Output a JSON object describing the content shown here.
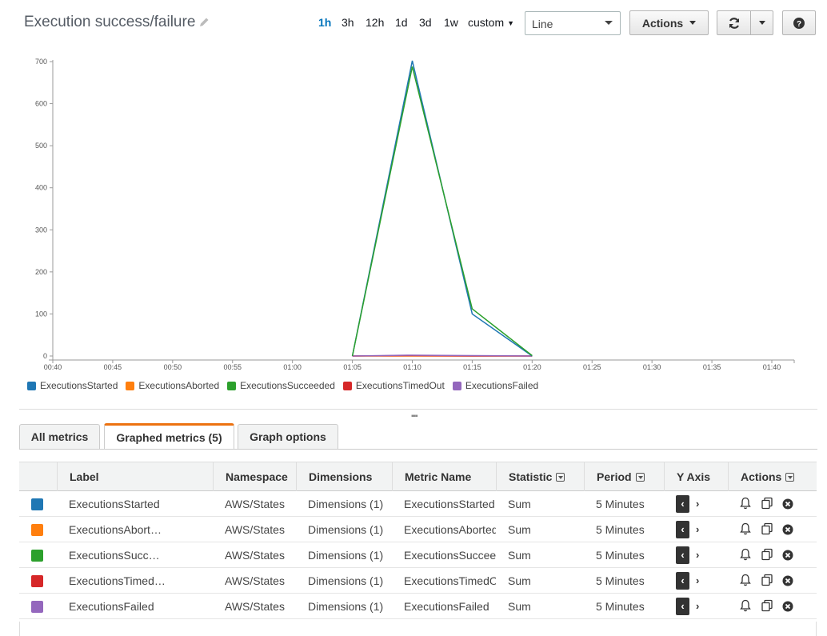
{
  "header": {
    "title": "Execution success/failure",
    "time_ranges": [
      "1h",
      "3h",
      "12h",
      "1d",
      "3d",
      "1w"
    ],
    "active_range": "1h",
    "custom_label": "custom",
    "graph_type": "Line",
    "actions_label": "Actions"
  },
  "chart_data": {
    "type": "line",
    "x": [
      "00:40",
      "00:45",
      "00:50",
      "00:55",
      "01:00",
      "01:05",
      "01:10",
      "01:15",
      "01:20",
      "01:25",
      "01:30",
      "01:35",
      "01:40"
    ],
    "ylim": [
      0,
      700
    ],
    "yticks": [
      "0",
      "100",
      "200",
      "300",
      "400",
      "500",
      "600",
      "700"
    ],
    "series": [
      {
        "name": "ExecutionsStarted",
        "color": "#1f77b4",
        "points": [
          [
            "01:05",
            0
          ],
          [
            "01:10",
            702
          ],
          [
            "01:15",
            100
          ],
          [
            "01:20",
            0
          ]
        ]
      },
      {
        "name": "ExecutionsAborted",
        "color": "#ff7f0e",
        "points": [
          [
            "01:05",
            0
          ],
          [
            "01:10",
            0
          ],
          [
            "01:15",
            0
          ],
          [
            "01:20",
            0
          ]
        ]
      },
      {
        "name": "ExecutionsSucceeded",
        "color": "#2ca02c",
        "points": [
          [
            "01:05",
            0
          ],
          [
            "01:10",
            688
          ],
          [
            "01:15",
            112
          ],
          [
            "01:20",
            1
          ]
        ]
      },
      {
        "name": "ExecutionsTimedOut",
        "color": "#d62728",
        "points": [
          [
            "01:05",
            0
          ],
          [
            "01:10",
            1
          ],
          [
            "01:15",
            0
          ],
          [
            "01:20",
            0
          ]
        ]
      },
      {
        "name": "ExecutionsFailed",
        "color": "#9467bd",
        "points": [
          [
            "01:05",
            0
          ],
          [
            "01:10",
            2
          ],
          [
            "01:15",
            1
          ],
          [
            "01:20",
            0
          ]
        ]
      }
    ]
  },
  "tabs": [
    "All metrics",
    "Graphed metrics (5)",
    "Graph options"
  ],
  "active_tab": "Graphed metrics (5)",
  "table": {
    "columns": [
      "Label",
      "Namespace",
      "Dimensions",
      "Metric Name",
      "Statistic",
      "Period",
      "Y Axis",
      "Actions"
    ],
    "rows": [
      {
        "color": "#1f77b4",
        "label": "ExecutionsStarted",
        "namespace": "AWS/States",
        "dimensions": "Dimensions (1)",
        "metric": "ExecutionsStarted",
        "statistic": "Sum",
        "period": "5 Minutes"
      },
      {
        "color": "#ff7f0e",
        "label": "ExecutionsAbort…",
        "namespace": "AWS/States",
        "dimensions": "Dimensions (1)",
        "metric": "ExecutionsAborted",
        "statistic": "Sum",
        "period": "5 Minutes"
      },
      {
        "color": "#2ca02c",
        "label": "ExecutionsSucc…",
        "namespace": "AWS/States",
        "dimensions": "Dimensions (1)",
        "metric": "ExecutionsSucceeded",
        "statistic": "Sum",
        "period": "5 Minutes"
      },
      {
        "color": "#d62728",
        "label": "ExecutionsTimed…",
        "namespace": "AWS/States",
        "dimensions": "Dimensions (1)",
        "metric": "ExecutionsTimedOut",
        "statistic": "Sum",
        "period": "5 Minutes"
      },
      {
        "color": "#9467bd",
        "label": "ExecutionsFailed",
        "namespace": "AWS/States",
        "dimensions": "Dimensions (1)",
        "metric": "ExecutionsFailed",
        "statistic": "Sum",
        "period": "5 Minutes"
      }
    ]
  }
}
